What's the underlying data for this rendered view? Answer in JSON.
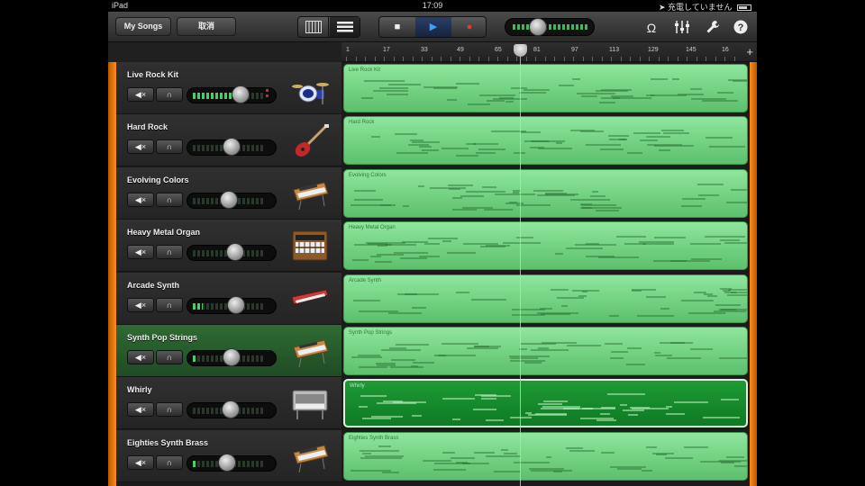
{
  "status_bar": {
    "device": "iPad",
    "time": "17:09",
    "charging": "充電していません"
  },
  "toolbar": {
    "my_songs_label": "My Songs",
    "undo_label": "取消",
    "colors": {
      "accent_blue": "#3aa0ff",
      "record_red": "#e33"
    }
  },
  "ruler": {
    "marks": [
      "1",
      "17",
      "33",
      "49",
      "65",
      "81",
      "97",
      "113",
      "129",
      "145",
      "16"
    ],
    "add_label": "+"
  },
  "tracks": [
    {
      "name": "Live Rock Kit",
      "region": "Live Rock Kit",
      "instrument": "drum-kit-icon",
      "level": 0.66,
      "meter": 0.62,
      "selected": false,
      "clip": true
    },
    {
      "name": "Hard Rock",
      "region": "Hard Rock",
      "instrument": "electric-guitar-icon",
      "level": 0.5,
      "meter": 0,
      "selected": false,
      "clip": false
    },
    {
      "name": "Evolving Colors",
      "region": "Evolving Colors",
      "instrument": "synth-icon",
      "level": 0.46,
      "meter": 0,
      "selected": false,
      "clip": false
    },
    {
      "name": "Heavy Metal Organ",
      "region": "Heavy Metal Organ",
      "instrument": "organ-icon",
      "level": 0.56,
      "meter": 0,
      "selected": false,
      "clip": false
    },
    {
      "name": "Arcade Synth",
      "region": "Arcade Synth",
      "instrument": "keyboard-icon",
      "level": 0.58,
      "meter": 0.14,
      "selected": false,
      "clip": false
    },
    {
      "name": "Synth Pop Strings",
      "region": "Synth Pop Strings",
      "instrument": "synth-icon",
      "level": 0.5,
      "meter": 0.06,
      "selected": true,
      "clip": false
    },
    {
      "name": "Whirly",
      "region": "Whirly",
      "instrument": "electric-piano-icon",
      "level": 0.48,
      "meter": 0,
      "selected": false,
      "clip": false,
      "active": true
    },
    {
      "name": "Eighties Synth Brass",
      "region": "Eighties Synth Brass",
      "instrument": "synth-icon",
      "level": 0.42,
      "meter": 0.06,
      "selected": false,
      "clip": false
    }
  ]
}
